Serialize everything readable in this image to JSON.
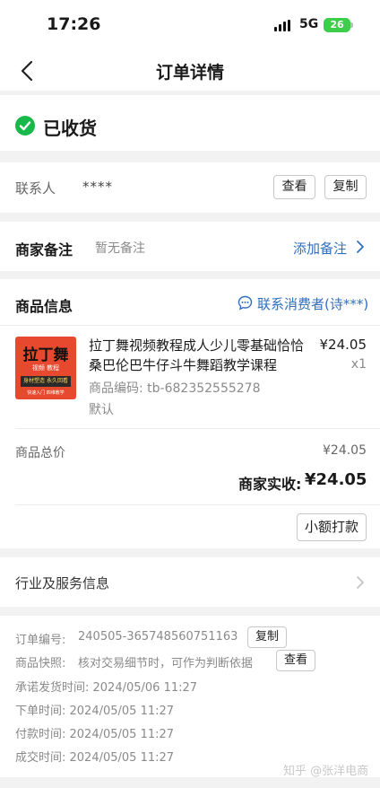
{
  "status_bar": {
    "time": "17:26",
    "network": "5G",
    "battery": "26"
  },
  "nav": {
    "title": "订单详情",
    "back_icon": "chevron-left-icon"
  },
  "order_status": {
    "text": "已收货",
    "icon": "check-circle-icon",
    "color": "#18b94a"
  },
  "contact": {
    "label": "联系人",
    "value": "****",
    "view_button": "查看",
    "copy_button": "复制"
  },
  "merchant_note": {
    "label": "商家备注",
    "value": "暂无备注",
    "action": "添加备注"
  },
  "product_section": {
    "title": "商品信息",
    "contact_consumer": "联系消费者(诗***)",
    "product": {
      "thumbnail": {
        "title": "拉丁舞",
        "line1": "视频 教程",
        "line2": "身材塑造 永久回看",
        "line3": "快速入门 四维教学"
      },
      "title": "拉丁舞视频教程成人少儿零基础恰恰桑巴伦巴牛仔斗牛舞蹈教学课程",
      "code": "商品编码: tb-682352555278",
      "sku": "默认",
      "price": "¥24.05",
      "quantity": "x1"
    },
    "total_label": "商品总价",
    "total_value": "¥24.05",
    "received_label": "商家实收:",
    "received_value": "¥24.05",
    "small_payment_button": "小额打款"
  },
  "industry_service": {
    "label": "行业及服务信息"
  },
  "order_info": {
    "order_no_label": "订单编号:",
    "order_no": "240505-365748560751163",
    "copy_button": "复制",
    "snapshot_label": "商品快照:",
    "snapshot_text": "核对交易细节时，可作为判断依据",
    "view_button": "查看",
    "promise_ship": "承诺发货时间:  2024/05/06 11:27",
    "order_time": "下单时间:  2024/05/05 11:27",
    "pay_time": "付款时间:  2024/05/05 11:27",
    "deal_time": "成交时间:  2024/05/05 11:27"
  },
  "watermark": "知乎 @张洋电商",
  "colors": {
    "accent_blue": "#2f6fbd",
    "success_green": "#18b94a",
    "background": "#f2f2f2"
  }
}
